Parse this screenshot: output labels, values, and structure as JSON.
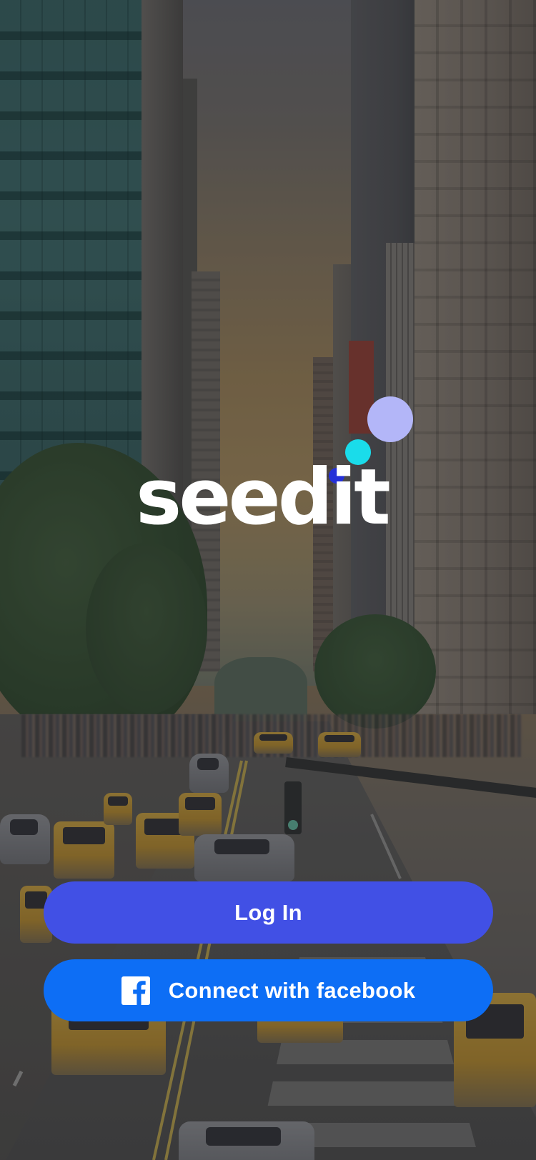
{
  "app": {
    "logo_text": "seedit"
  },
  "colors": {
    "login_button": "#4150e5",
    "facebook_button": "#0d6ef5",
    "logo_dot_large": "#b3b6f8",
    "logo_dot_medium": "#1adcea",
    "logo_dot_small": "#2530d8",
    "logo_text": "#ffffff"
  },
  "actions": {
    "login_label": "Log In",
    "facebook_label": "Connect with facebook",
    "facebook_icon": "facebook-icon"
  }
}
